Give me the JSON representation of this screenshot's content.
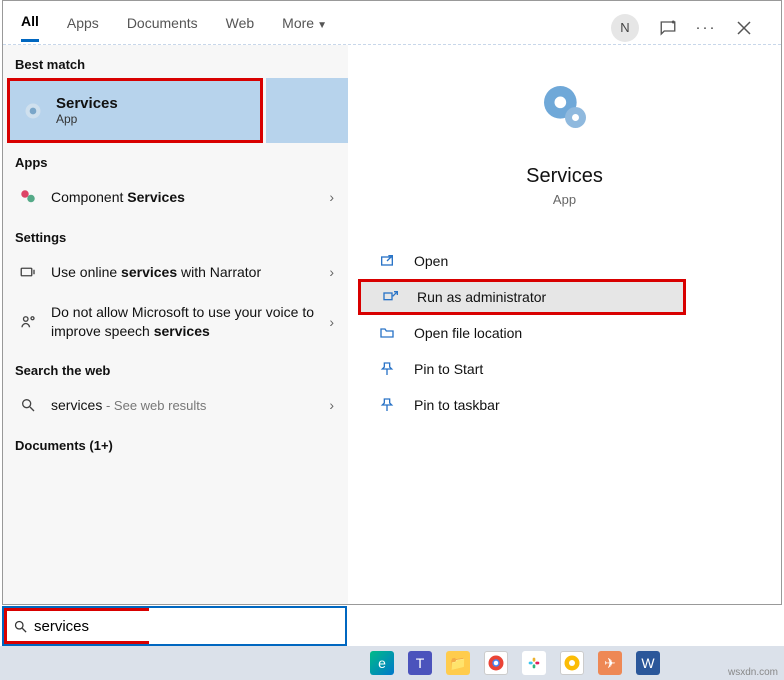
{
  "tabs": {
    "all": "All",
    "apps": "Apps",
    "documents": "Documents",
    "web": "Web",
    "more": "More"
  },
  "avatar": "N",
  "sections": {
    "best_match": "Best match",
    "apps": "Apps",
    "settings": "Settings",
    "search_web": "Search the web",
    "documents": "Documents (1+)"
  },
  "best": {
    "title": "Services",
    "sub": "App"
  },
  "rows": {
    "component_pre": "Component ",
    "component_bold": "Services",
    "narrator_pre": "Use online ",
    "narrator_bold": "services",
    "narrator_post": " with Narrator",
    "speech_pre": "Do not allow Microsoft to use your voice to improve speech ",
    "speech_bold": "services",
    "web_term": "services",
    "web_suffix": " - See web results"
  },
  "preview": {
    "title": "Services",
    "sub": "App"
  },
  "actions": {
    "open": "Open",
    "run_admin": "Run as administrator",
    "open_loc": "Open file location",
    "pin_start": "Pin to Start",
    "pin_taskbar": "Pin to taskbar"
  },
  "search": {
    "value": "services"
  },
  "watermark": "wsxdn.com"
}
